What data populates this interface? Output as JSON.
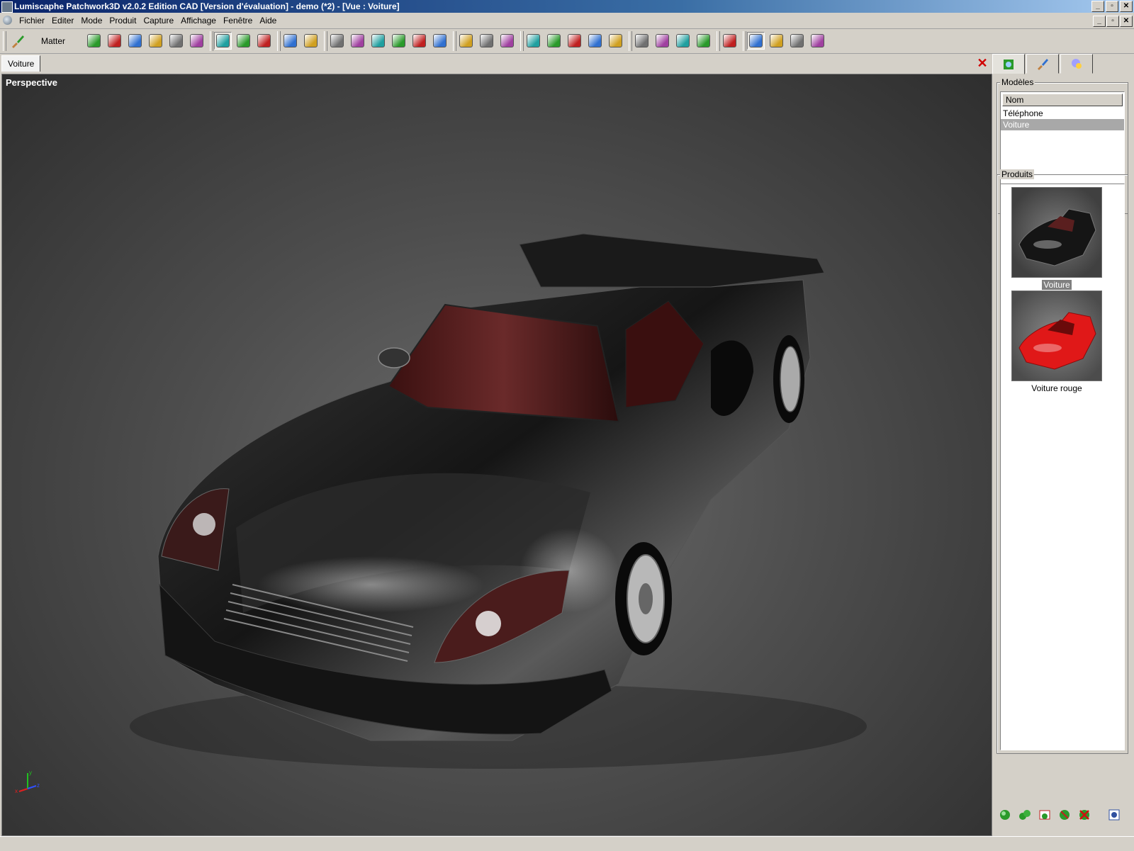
{
  "window": {
    "title": "Lumiscaphe Patchwork3D v2.0.2 Edition CAD [Version d'évaluation] - demo (*2) - [Vue : Voiture]",
    "controls": [
      "_",
      "▫",
      "✕"
    ]
  },
  "menubar": {
    "items": [
      "Fichier",
      "Editer",
      "Mode",
      "Produit",
      "Capture",
      "Affichage",
      "Fenêtre",
      "Aide"
    ],
    "mdi_controls": [
      "_",
      "▫",
      "✕"
    ]
  },
  "toolbar": {
    "mode_label": "Matter",
    "icons": [
      "paintbrush-icon",
      "new-icon",
      "open-icon",
      "save-icon",
      "save-all-icon",
      "pin-icon",
      "sphere-icon",
      "select-arrow-icon",
      "add-material-icon",
      "replace-material-icon",
      "layers-icon",
      "zoom-icon",
      "pan-hand-icon",
      "orbit-icon",
      "fly-icon",
      "walk-icon",
      "rotate-left-icon",
      "rotate-right-icon",
      "link-icon",
      "snapshot-icon",
      "render-icon",
      "delete-red-icon",
      "cut-red-icon",
      "light-icon",
      "zoom-fit-icon",
      "grid-icon",
      "edit-render-icon",
      "render-settings-icon",
      "tools-icon",
      "camera-icon",
      "window-icon",
      "layout-single-icon",
      "layout-double-icon",
      "layout-quad-icon",
      "help-icon"
    ]
  },
  "document_tabs": {
    "active": "Voiture",
    "close_symbol": "✕"
  },
  "viewport": {
    "label": "Perspective",
    "axis": {
      "x": "x",
      "y": "y",
      "z": "z"
    }
  },
  "right_panel": {
    "tabs": [
      "models-tab-icon",
      "materials-tab-icon",
      "lights-tab-icon"
    ],
    "models_group": {
      "title": "Modèles",
      "header": "Nom",
      "rows": [
        "Téléphone",
        "Voiture"
      ],
      "selected_index": 1
    },
    "products_group": {
      "title": "Produits",
      "items": [
        {
          "label": "Voiture",
          "selected": true,
          "color": "#1c1c1c"
        },
        {
          "label": "Voiture rouge",
          "selected": false,
          "color": "#e01818"
        }
      ]
    },
    "bottom_icons": [
      "add-product-icon",
      "link-product-icon",
      "snapshot-product-icon",
      "refresh-product-icon",
      "delete-product-icon",
      "settings-product-icon"
    ]
  },
  "colors": {
    "titlebar_start": "#0a246a",
    "accent_red": "#e01818",
    "accent_green": "#2a9a2a"
  }
}
